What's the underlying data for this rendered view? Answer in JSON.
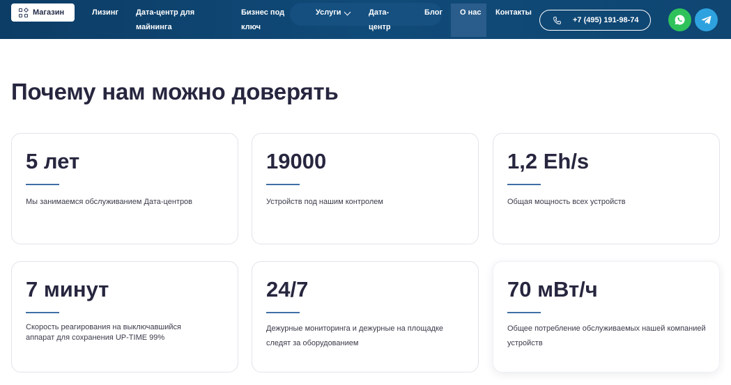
{
  "nav": {
    "shop_label": "Магазин",
    "items": [
      {
        "label": "Лизинг"
      },
      {
        "label": "Дата-центр для майнинга"
      },
      {
        "label": "Бизнес под ключ"
      },
      {
        "label": "Услуги"
      },
      {
        "label": "Дата-центр"
      },
      {
        "label": "Блог"
      },
      {
        "label": "О нас",
        "active": true
      },
      {
        "label": "Контакты"
      }
    ],
    "phone": "+7 (495) 191-98-74",
    "icons": [
      "grid-icon",
      "chevron-down-icon",
      "phone-icon",
      "whatsapp-icon",
      "telegram-icon"
    ],
    "colors": {
      "background": "#0f4672",
      "active_item": "#2a5d8b",
      "whatsapp": "#2fc25b",
      "telegram": "#2ea2df"
    }
  },
  "main": {
    "title": "Почему нам можно доверять",
    "cards": [
      {
        "value": "5 лет",
        "desc": "Мы занимаемся обслуживанием Дата-центров"
      },
      {
        "value": "19000",
        "desc": "Устройств под нашим контролем"
      },
      {
        "value": "1,2 Eh/s",
        "desc": "Общая мощность всех устройств"
      },
      {
        "value": "7 минут",
        "desc": "Скорость реагирования на выключавшийся аппарат для сохранения UP-TIME 99%"
      },
      {
        "value": "24/7",
        "desc": "Дежурные мониторинга и дежурные на площадке следят за оборудованием"
      },
      {
        "value": "70 мВт/ч",
        "desc": "Общее потребление обслуживаемых нашей компанией устройств"
      }
    ],
    "accent_color": "#3f6fa6"
  }
}
